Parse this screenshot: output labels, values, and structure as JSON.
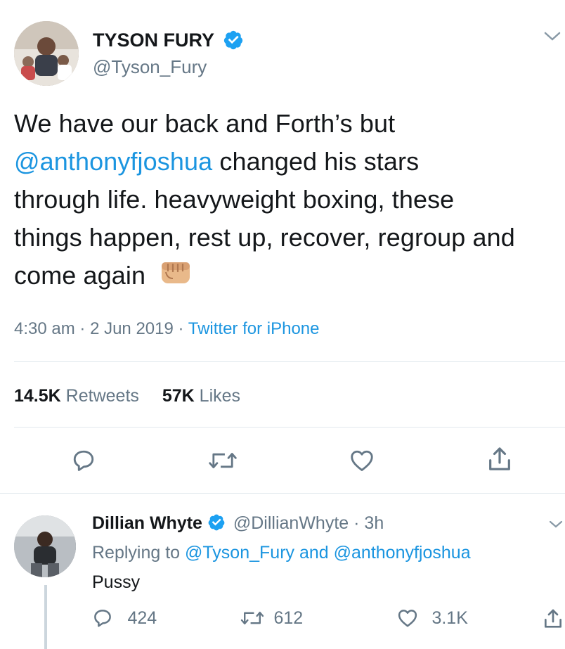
{
  "main_tweet": {
    "author_name": "TYSON FURY",
    "handle": "@Tyson_Fury",
    "text_part1": "We have our back and Forth’s but",
    "mention": "@anthonyfjoshua",
    "text_part2": " changed his stars",
    "text_line3": "through life. heavyweight boxing, these",
    "text_line4": "things happen, rest up, recover, regroup and",
    "text_line5": "come again",
    "time": "4:30 am",
    "sep1": "·",
    "date": "2 Jun 2019",
    "sep2": "·",
    "source": "Twitter for iPhone",
    "retweets_count": "14.5K",
    "retweets_label": "Retweets",
    "likes_count": "57K",
    "likes_label": "Likes"
  },
  "reply": {
    "author_name": "Dillian Whyte",
    "handle": "@DillianWhyte",
    "sep": "·",
    "time": "3h",
    "replying_prefix": "Replying to",
    "replying_user1": "@Tyson_Fury",
    "replying_and": "and",
    "replying_user2": "@anthonyfjoshua",
    "text": "Pussy",
    "reply_count": "424",
    "retweet_count": "612",
    "like_count": "3.1K"
  },
  "colors": {
    "link": "#1b95e0",
    "muted": "#657786",
    "verified": "#1da1f2",
    "text": "#14171a"
  },
  "icons": {
    "verified": "verified-badge-icon",
    "menu": "chevron-down-icon",
    "reply": "reply-icon",
    "retweet": "retweet-icon",
    "like": "heart-icon",
    "share": "share-icon",
    "emoji": "oncoming-fist-emoji"
  }
}
